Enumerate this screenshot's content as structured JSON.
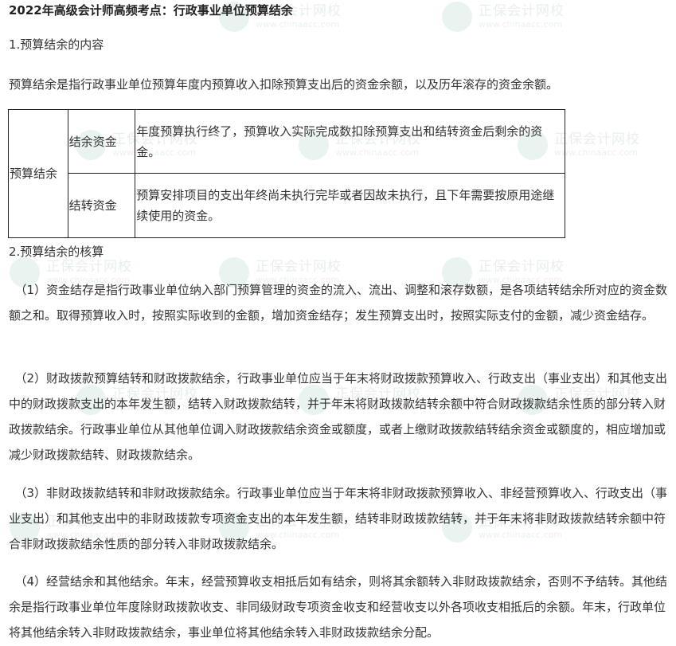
{
  "title": "2022年高级会计师高频考点：行政事业单位预算结余",
  "watermark": {
    "name": "正保会计网校",
    "url": "www.chinaacc.com"
  },
  "section1": {
    "heading": "1.预算结余的内容",
    "intro": "预算结余是指行政事业单位预算年度内预算收入扣除预算支出后的资金余额，以及历年滚存的资金余额。"
  },
  "table": {
    "group": "预算结余",
    "rows": [
      {
        "name": "结余资金",
        "desc": "年度预算执行终了，预算收入实际完成数扣除预算支出和结转资金后剩余的资金。"
      },
      {
        "name": "结转资金",
        "desc": "预算安排项目的支出年终尚未执行完毕或者因故未执行，且下年需要按原用途继续使用的资金。"
      }
    ]
  },
  "section2": {
    "heading": "2.预算结余的核算",
    "paragraphs": [
      "（1）资金结存是指行政事业单位纳入部门预算管理的资金的流入、流出、调整和滚存数额，是各项结转结余所对应的资金数额之和。取得预算收入时，按照实际收到的金额，增加资金结存；发生预算支出时，按照实际支付的金额，减少资金结存。",
      "（2）财政拨款预算结转和财政拨款结余，行政事业单位应当于年末将财政拨款预算收入、行政支出（事业支出）和其他支出中的财政拨款支出的本年发生额，结转入财政拨款结转，并于年末将财政拨款结转余额中符合财政拨款结余性质的部分转入财政拨款结余。行政事业单位从其他单位调入财政拨款结余资金或额度，或者上缴财政拨款结转结余资金或额度的，相应增加或减少财政拨款结转、财政拨款结余。",
      "（3）非财政拨款结转和非财政拨款结余。行政事业单位应当于年末将非财政拨款预算收入、非经营预算收入、行政支出（事业支出）和其他支出中的非财政拨款专项资金支出的本年发生额，结转非财政拨款结转，并于年末将非财政拨款结转余额中符合非财政拨款结余性质的部分转入非财政拨款结余。",
      "（4）经营结余和其他结余。年末，经营预算收支相抵后如有结余，则将其余额转入非财政拨款结余，否则不予结转。其他结余是指行政事业单位年度除财政拨款收支、非同级财政专项资金收支和经营收支以外各项收支相抵后的余额。年末，行政单位将其他结余转入非财政拨款结余，事业单位将其他结余转入非财政拨款结余分配。"
    ]
  }
}
